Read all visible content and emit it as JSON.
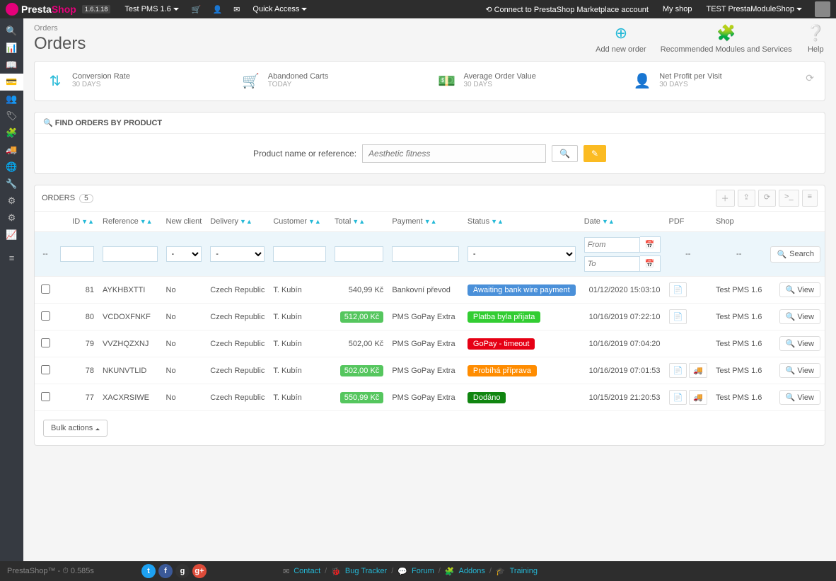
{
  "topbar": {
    "brand_a": "Presta",
    "brand_b": "Shop",
    "version": "1.6.1.18",
    "shop_context": "Test PMS 1.6",
    "quick_access": "Quick Access",
    "marketplace": "Connect to PrestaShop Marketplace account",
    "my_shop": "My shop",
    "user": "TEST PrestaModuleShop"
  },
  "header": {
    "breadcrumb": "Orders",
    "title": "Orders",
    "actions": {
      "add": "Add new order",
      "modules": "Recommended Modules and Services",
      "help": "Help"
    }
  },
  "kpi": [
    {
      "title": "Conversion Rate",
      "sub": "30 DAYS"
    },
    {
      "title": "Abandoned Carts",
      "sub": "TODAY"
    },
    {
      "title": "Average Order Value",
      "sub": "30 DAYS"
    },
    {
      "title": "Net Profit per Visit",
      "sub": "30 DAYS"
    }
  ],
  "find": {
    "heading": "FIND ORDERS BY PRODUCT",
    "label": "Product name or reference:",
    "placeholder": "Aesthetic fitness"
  },
  "orders_panel": {
    "title": "ORDERS",
    "count": "5",
    "bulk": "Bulk actions",
    "search_btn": "Search",
    "view_btn": "View",
    "date_from": "From",
    "date_to": "To",
    "columns": {
      "id": "ID",
      "reference": "Reference",
      "new_client": "New client",
      "delivery": "Delivery",
      "customer": "Customer",
      "total": "Total",
      "payment": "Payment",
      "status": "Status",
      "date": "Date",
      "pdf": "PDF",
      "shop": "Shop"
    }
  },
  "orders": [
    {
      "id": "81",
      "ref": "AYKHBXTTI",
      "new": "No",
      "delivery": "Czech Republic",
      "customer": "T. Kubín",
      "total": "540,99 Kč",
      "total_badge": false,
      "payment": "Bankovní převod",
      "status": "Awaiting bank wire payment",
      "status_color": "#4a90d9",
      "date": "01/12/2020 15:03:10",
      "pdf": [
        "file"
      ],
      "shop": "Test PMS 1.6"
    },
    {
      "id": "80",
      "ref": "VCDOXFNKF",
      "new": "No",
      "delivery": "Czech Republic",
      "customer": "T. Kubín",
      "total": "512,00 Kč",
      "total_badge": true,
      "payment": "PMS GoPay Extra",
      "status": "Platba byla přijata",
      "status_color": "#32cd32",
      "date": "10/16/2019 07:22:10",
      "pdf": [
        "file"
      ],
      "shop": "Test PMS 1.6"
    },
    {
      "id": "79",
      "ref": "VVZHQZXNJ",
      "new": "No",
      "delivery": "Czech Republic",
      "customer": "T. Kubín",
      "total": "502,00 Kč",
      "total_badge": false,
      "payment": "PMS GoPay Extra",
      "status": "GoPay - timeout",
      "status_color": "#e60014",
      "date": "10/16/2019 07:04:20",
      "pdf": [],
      "shop": "Test PMS 1.6"
    },
    {
      "id": "78",
      "ref": "NKUNVTLID",
      "new": "No",
      "delivery": "Czech Republic",
      "customer": "T. Kubín",
      "total": "502,00 Kč",
      "total_badge": true,
      "payment": "PMS GoPay Extra",
      "status": "Probíhá příprava",
      "status_color": "#ff8c00",
      "date": "10/16/2019 07:01:53",
      "pdf": [
        "file",
        "truck"
      ],
      "shop": "Test PMS 1.6"
    },
    {
      "id": "77",
      "ref": "XACXRSIWE",
      "new": "No",
      "delivery": "Czech Republic",
      "customer": "T. Kubín",
      "total": "550,99 Kč",
      "total_badge": true,
      "payment": "PMS GoPay Extra",
      "status": "Dodáno",
      "status_color": "#108510",
      "date": "10/15/2019 21:20:53",
      "pdf": [
        "file",
        "truck"
      ],
      "shop": "Test PMS 1.6"
    }
  ],
  "footer": {
    "left": "PrestaShop™ - ⏱ 0.585s",
    "links": {
      "contact": "Contact",
      "bug": "Bug Tracker",
      "forum": "Forum",
      "addons": "Addons",
      "training": "Training"
    }
  }
}
